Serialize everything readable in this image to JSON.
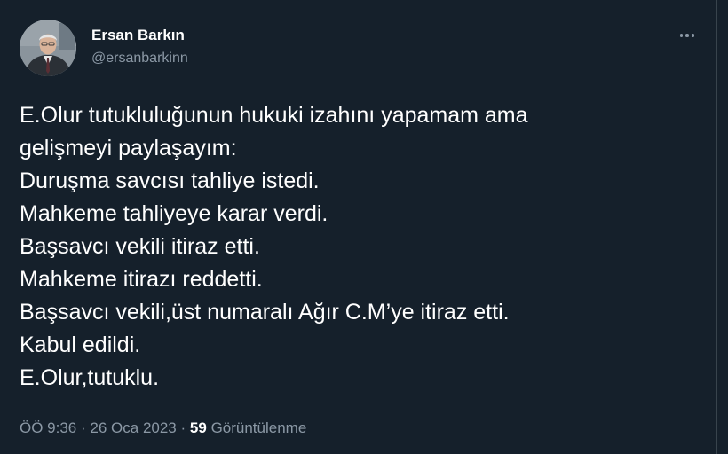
{
  "author": {
    "display_name": "Ersan Barkın",
    "handle": "@ersanbarkinn"
  },
  "tweet": {
    "lines": [
      "E.Olur tutukluluğunun hukuki izahını yapamam ama",
      "gelişmeyi paylaşayım:",
      "Duruşma savcısı tahliye istedi.",
      "Mahkeme tahliyeye karar verdi.",
      "Başsavcı vekili itiraz etti.",
      "Mahkeme itirazı reddetti.",
      "Başsavcı vekili,üst numaralı Ağır C.M’ye itiraz etti.",
      "Kabul edildi.",
      "E.Olur,tutuklu."
    ]
  },
  "meta": {
    "time": "ÖÖ 9:36",
    "separator": "·",
    "date": "26 Oca 2023",
    "views_count": "59",
    "views_label": "Görüntülenme"
  },
  "icons": {
    "more": "more-horizontal-icon"
  },
  "colors": {
    "background": "#15202b",
    "primary_text": "#ffffff",
    "secondary_text": "#8b98a5",
    "border": "#38444d"
  }
}
